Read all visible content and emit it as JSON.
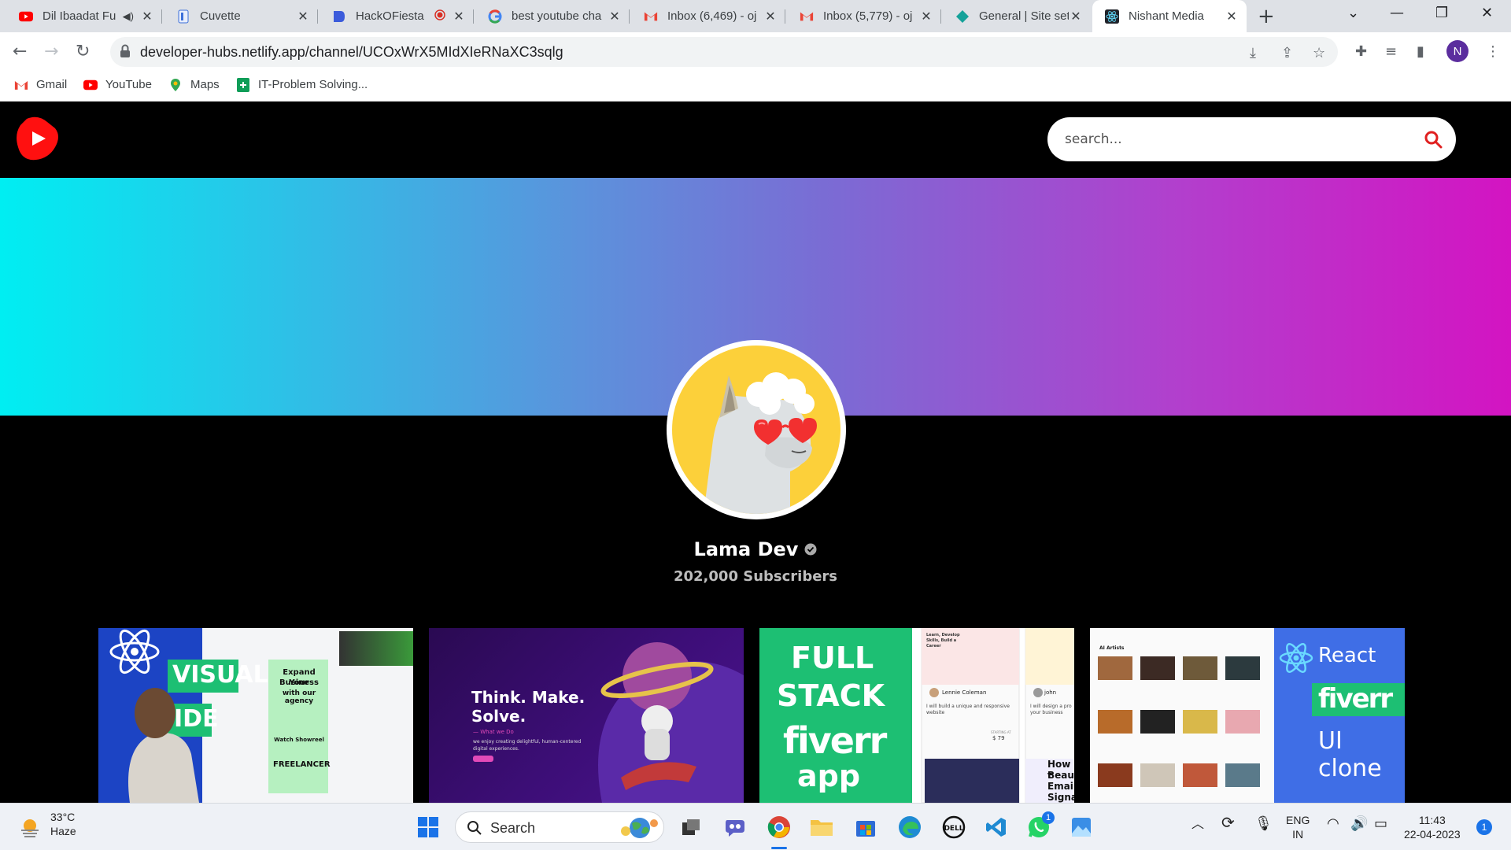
{
  "browser": {
    "tabs": [
      {
        "title": "Dil Ibaadat Fu",
        "icon": "youtube-icon",
        "audio": true
      },
      {
        "title": "Cuvette",
        "icon": "cuvette-icon"
      },
      {
        "title": "HackOFiesta",
        "icon": "hackofiesta-icon",
        "recording": true
      },
      {
        "title": "best youtube cha",
        "icon": "google-icon"
      },
      {
        "title": "Inbox (6,469) - oj",
        "icon": "gmail-icon"
      },
      {
        "title": "Inbox (5,779) - oj",
        "icon": "gmail-icon"
      },
      {
        "title": "General | Site sett",
        "icon": "netlify-icon"
      },
      {
        "title": "Nishant Media",
        "icon": "react-icon",
        "active": true
      }
    ],
    "url": "developer-hubs.netlify.app/channel/UCOxWrX5MIdXIeRNaXC3sqlg",
    "profile_initial": "N",
    "bookmarks": [
      {
        "label": "Gmail",
        "icon": "gmail-icon"
      },
      {
        "label": "YouTube",
        "icon": "youtube-icon"
      },
      {
        "label": "Maps",
        "icon": "maps-icon"
      },
      {
        "label": "IT-Problem Solving...",
        "icon": "sheets-icon"
      }
    ]
  },
  "app": {
    "search_placeholder": "search...",
    "channel_name": "Lama Dev",
    "subscribers": "202,000 Subscribers",
    "videos": [
      {
        "thumb_text": [
          "VISUAL",
          "IDE"
        ],
        "side_text": [
          "Expand Your",
          "Business",
          "with our agency"
        ],
        "extra": [
          "Watch Showreel",
          "FREELANCER"
        ]
      },
      {
        "thumb_text": [
          "Think. Make.",
          "Solve."
        ],
        "sub": "— What we Do",
        "desc": "we enjoy creating delightful, human-centered digital experiences."
      },
      {
        "thumb_text": [
          "FULL",
          "STACK",
          "fiverr",
          "app"
        ],
        "side_text": [
          "Learn, Develop Skills, Build a Career",
          "Lennie Coleman",
          "I will build a unique and responsive website",
          "STARTING AT",
          "$ 79",
          "john",
          "I will design a pro your business",
          "How t",
          "Beau",
          "Emai",
          "Signa"
        ]
      },
      {
        "thumb_text": [
          "React",
          "fiverr",
          "UI clone"
        ],
        "side_text": [
          "AI Artists"
        ]
      }
    ]
  },
  "taskbar": {
    "weather_temp": "33°C",
    "weather_desc": "Haze",
    "search_label": "Search",
    "lang": "ENG",
    "region": "IN",
    "time": "11:43",
    "date": "22-04-2023",
    "notifications": "1",
    "whatsapp_badge": "1"
  },
  "colors": {
    "banner_start": "#00eef2",
    "banner_end": "#d314c2",
    "fiverr_green": "#1dbf73",
    "search_icon": "#e02020"
  }
}
